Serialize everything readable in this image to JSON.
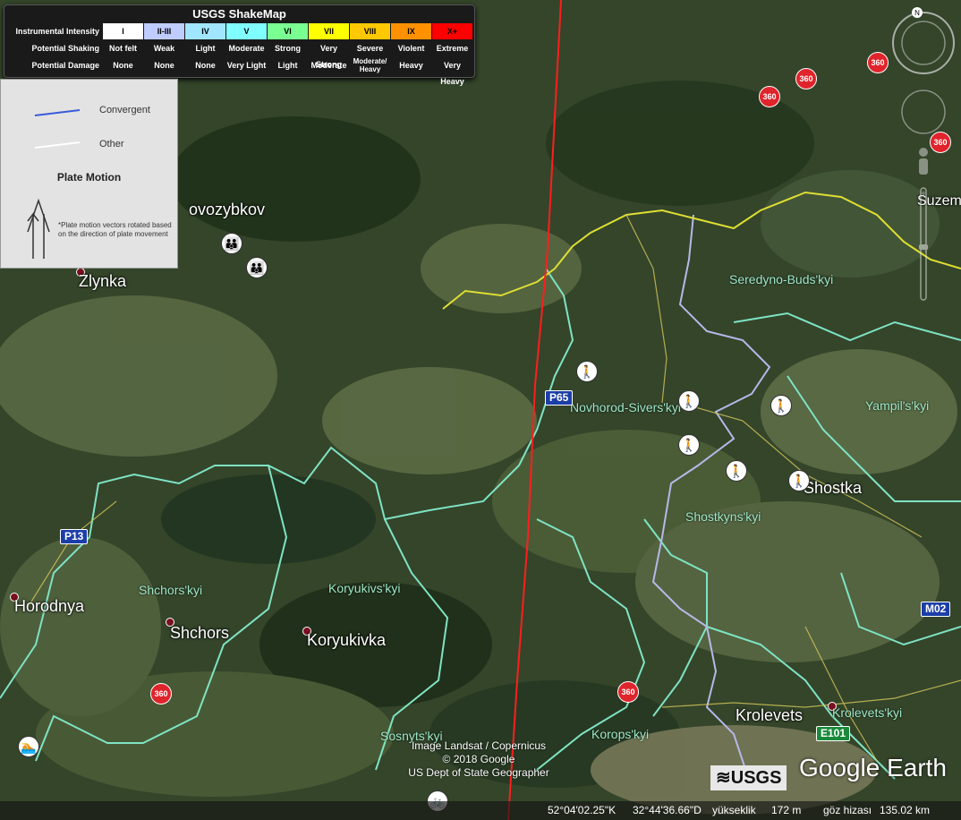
{
  "legend": {
    "title": "USGS ShakeMap",
    "rows": [
      {
        "label": "Instrumental Intensity",
        "cells": [
          "I",
          "II-III",
          "IV",
          "V",
          "VI",
          "VII",
          "VIII",
          "IX",
          "X+"
        ]
      },
      {
        "label": "Potential Shaking",
        "cells": [
          "Not felt",
          "Weak",
          "Light",
          "Moderate",
          "Strong",
          "Very Strong",
          "Severe",
          "Violent",
          "Extreme"
        ]
      },
      {
        "label": "Potential Damage",
        "cells": [
          "None",
          "None",
          "None",
          "Very Light",
          "Light",
          "Moderate",
          "Moderate/ Heavy",
          "Heavy",
          "Very Heavy"
        ]
      }
    ],
    "colors": [
      "#ffffff",
      "#bfccff",
      "#a0e6ff",
      "#80ffff",
      "#7aff93",
      "#ffff00",
      "#ffc800",
      "#ff9100",
      "#ff0000"
    ]
  },
  "plate_legend": {
    "convergent": "Convergent",
    "other": "Other",
    "motion_title": "Plate Motion",
    "note": "*Plate motion vectors rotated based on the direction of plate movement",
    "convergent_color": "#3a5bd9",
    "other_color": "#ffffff"
  },
  "towns": [
    {
      "id": "zlynka",
      "name": "Zlynka"
    },
    {
      "id": "novozybkov",
      "name": "Novozybkov"
    },
    {
      "id": "horodnya",
      "name": "Horodnya"
    },
    {
      "id": "shchors",
      "name": "Shchors"
    },
    {
      "id": "koryukivka",
      "name": "Koryukivka"
    },
    {
      "id": "shostka",
      "name": "Shostka"
    },
    {
      "id": "krolevets",
      "name": "Krolevets"
    },
    {
      "id": "suzem",
      "name": "Suzem"
    }
  ],
  "districts": [
    {
      "id": "seredyno",
      "name": "Seredyno-Buds'kyi"
    },
    {
      "id": "novhorod",
      "name": "Novhorod-Sivers'kyi"
    },
    {
      "id": "yampil",
      "name": "Yampil's'kyi"
    },
    {
      "id": "shostkyns",
      "name": "Shostkyns'kyi"
    },
    {
      "id": "shchorskyi",
      "name": "Shchors'kyi"
    },
    {
      "id": "koryukivs",
      "name": "Koryukivs'kyi"
    },
    {
      "id": "sosnyts",
      "name": "Sosnyts'kyi"
    },
    {
      "id": "korops",
      "name": "Korops'kyi"
    },
    {
      "id": "krolevetskyi",
      "name": "Krolevets'kyi"
    }
  ],
  "roads": {
    "p65": "P65",
    "p13": "P13",
    "m02": "M02",
    "e101": "E101"
  },
  "badge_360": "360",
  "credits": {
    "line1": "Image Landsat / Copernicus",
    "line2": "© 2018 Google",
    "line3": "US Dept of State Geographer"
  },
  "brand": {
    "usgs": "≋USGS",
    "google_earth": "Google Earth"
  },
  "status": {
    "lat": "52°04'02.25\"K",
    "lon": "32°44'36.66\"D",
    "elev_label": "yükseklik",
    "elev": "172 m",
    "eye_label": "göz hizası",
    "eye": "135.02 km"
  }
}
